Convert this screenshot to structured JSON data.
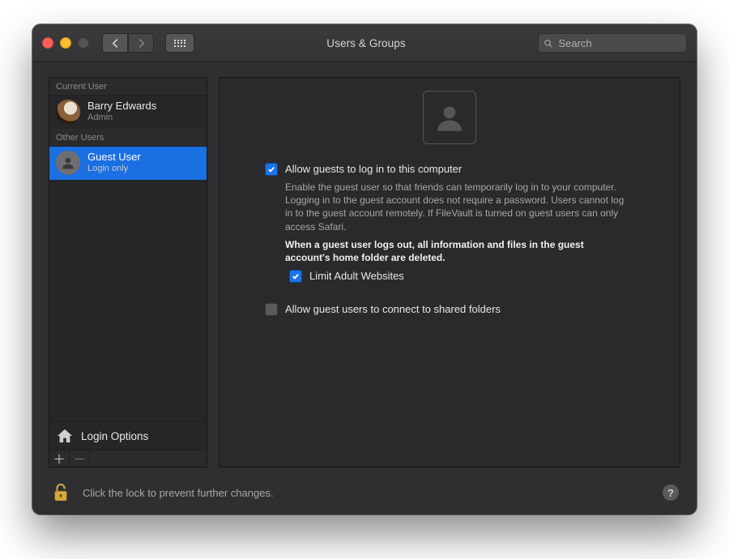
{
  "window": {
    "title": "Users & Groups"
  },
  "search": {
    "placeholder": "Search",
    "value": ""
  },
  "sidebar": {
    "sections": {
      "current_header": "Current User",
      "other_header": "Other Users"
    },
    "current_user": {
      "name": "Barry Edwards",
      "role": "Admin",
      "avatar_kind": "eagle"
    },
    "other_users": [
      {
        "name": "Guest User",
        "role": "Login only",
        "selected": true
      }
    ],
    "login_options_label": "Login Options"
  },
  "main": {
    "allow_guests_label": "Allow guests to log in to this computer",
    "allow_guests_checked": true,
    "allow_guests_desc": "Enable the guest user so that friends can temporarily log in to your computer. Logging in to the guest account does not require a password. Users cannot log in to the guest account remotely. If FileVault is turned on guest users can only access Safari.",
    "allow_guests_warning": "When a guest user logs out, all information and files in the guest account's home folder are deleted.",
    "limit_adult_label": "Limit Adult Websites",
    "limit_adult_checked": true,
    "shared_folders_label": "Allow guest users to connect to shared folders",
    "shared_folders_checked": false
  },
  "footer": {
    "lock_text": "Click the lock to prevent further changes.",
    "lock_state": "unlocked"
  }
}
